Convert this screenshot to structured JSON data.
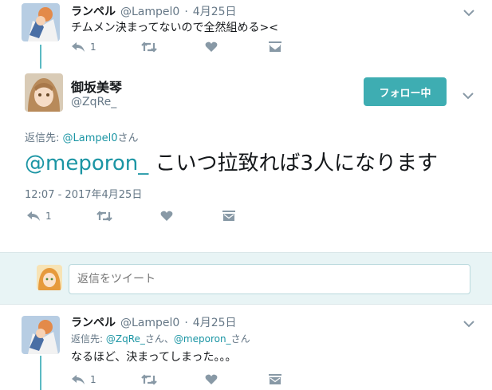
{
  "tweet1": {
    "name": "ランペル",
    "handle": "@Lampel0",
    "sep": "·",
    "date": "4月25日",
    "text": "チムメン決まってないので全然組める><",
    "reply_count": "1"
  },
  "main_tweet": {
    "name": "御坂美琴",
    "handle": "@ZqRe_",
    "follow_label": "フォロー中",
    "reply_to_prefix": "返信先: ",
    "reply_to_user": "@Lampel0",
    "reply_to_suffix": "さん",
    "mention": "@meporon_",
    "text": " こいつ拉致れば3人になります",
    "timestamp": "12:07 - 2017年4月25日",
    "reply_count": "1"
  },
  "reply_box": {
    "placeholder": "返信をツイート"
  },
  "tweet3": {
    "name": "ランペル",
    "handle": "@Lampel0",
    "sep": "·",
    "date": "4月25日",
    "reply_to_prefix": "返信先: ",
    "reply_to_user1": "@ZqRe_",
    "reply_to_mid": "さん、",
    "reply_to_user2": "@meporon_",
    "reply_to_suffix": "さん",
    "text": "なるほど、決まってしまった。。。",
    "reply_count": "1"
  },
  "colors": {
    "accent": "#1b95a4",
    "follow_button": "#3eadb2",
    "thread_line": "#5bbac3",
    "reply_bar_bg": "#e8f4f5"
  },
  "icons": [
    "reply-icon",
    "retweet-icon",
    "like-icon",
    "dm-icon",
    "chevron-down-icon"
  ]
}
